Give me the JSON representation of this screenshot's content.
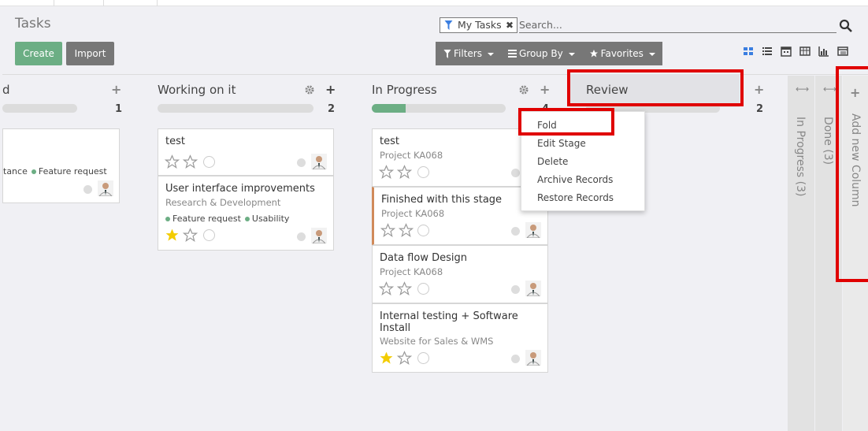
{
  "page": {
    "title": "Tasks"
  },
  "buttons": {
    "create": "Create",
    "import": "Import"
  },
  "search": {
    "facet": "My Tasks",
    "placeholder": "Search..."
  },
  "filter_bar": {
    "filters": "Filters",
    "group_by": "Group By",
    "favorites": "Favorites"
  },
  "view_icons": [
    "kanban-view-icon",
    "list-view-icon",
    "calendar-view-icon",
    "pivot-view-icon",
    "graph-view-icon",
    "activity-view-icon"
  ],
  "columns": [
    {
      "title": "d",
      "count": "1",
      "progress": 0
    },
    {
      "title": "Working on it",
      "count": "2",
      "progress": 0
    },
    {
      "title": "In Progress",
      "count": "4",
      "progress": 0.25
    },
    {
      "title": "Review",
      "count": "2",
      "progress": 0
    }
  ],
  "cards": {
    "col0": [
      {
        "tags": [
          "tance",
          "Feature request"
        ]
      }
    ],
    "col1": [
      {
        "title": "test"
      },
      {
        "title": "User interface improvements",
        "project": "Research & Development",
        "tags": [
          "Feature request",
          "Usability"
        ],
        "starred": true
      }
    ],
    "col2": [
      {
        "title": "test",
        "project": "Project KA068"
      },
      {
        "title": "Finished with this stage",
        "project": "Project KA068"
      },
      {
        "title": "Data flow Design",
        "project": "Project KA068"
      },
      {
        "title": "Internal testing + Software Install",
        "project": "Website for Sales & WMS",
        "starred": true
      }
    ]
  },
  "menu": {
    "fold": "Fold",
    "edit": "Edit Stage",
    "delete": "Delete",
    "archive": "Archive Records",
    "restore": "Restore Records"
  },
  "folded": [
    {
      "label": "In Progress (3)"
    },
    {
      "label": "Done (3)"
    }
  ],
  "add_column": "Add new Column",
  "colors": {
    "primary": "#6cae84",
    "secondary": "#777777",
    "highlight": "#e00000",
    "star": "#f3cc00"
  }
}
